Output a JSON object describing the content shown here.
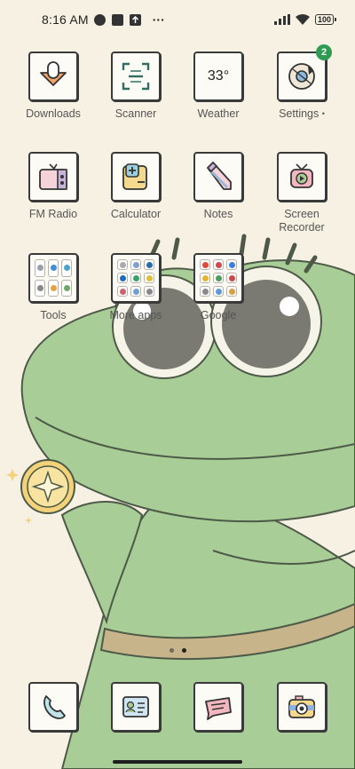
{
  "status_bar": {
    "time": "8:16 AM",
    "more": "···",
    "battery": "100"
  },
  "apps": [
    {
      "label": "Downloads",
      "icon": "download-icon"
    },
    {
      "label": "Scanner",
      "icon": "scanner-icon"
    },
    {
      "label": "Weather",
      "icon": "weather-icon",
      "icon_text": "33°"
    },
    {
      "label": "Settings",
      "icon": "settings-icon",
      "badge": "2",
      "suffix": "•"
    },
    {
      "label": "FM Radio",
      "icon": "radio-icon"
    },
    {
      "label": "Calculator",
      "icon": "calculator-icon"
    },
    {
      "label": "Notes",
      "icon": "notes-icon"
    },
    {
      "label": "Screen Recorder",
      "label_line1": "Screen",
      "label_line2": "Recorder",
      "icon": "screen-recorder-icon"
    },
    {
      "label": "Tools",
      "icon": "folder-icon"
    },
    {
      "label": "More apps",
      "icon": "folder-icon"
    },
    {
      "label": "Google",
      "icon": "folder-icon"
    }
  ],
  "dock": [
    {
      "icon": "phone-icon"
    },
    {
      "icon": "contacts-icon"
    },
    {
      "icon": "messages-icon"
    },
    {
      "icon": "camera-icon"
    }
  ],
  "page_indicator": {
    "pages": 2,
    "current": 2
  },
  "colors": {
    "background": "#f7f1e4",
    "frog_green": "#a9cd96",
    "badge_green": "#2e9b52"
  }
}
